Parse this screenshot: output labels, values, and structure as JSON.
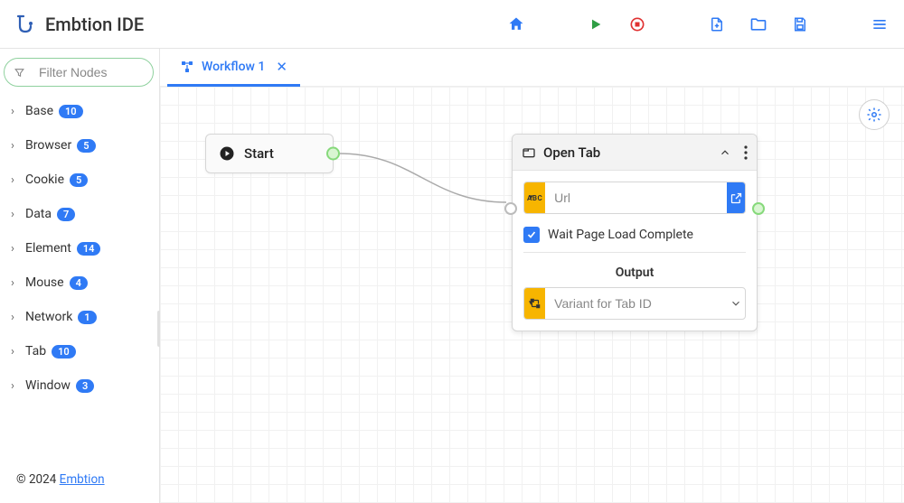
{
  "brand": {
    "title": "Embtion IDE"
  },
  "filter": {
    "placeholder": "Filter Nodes"
  },
  "categories": [
    {
      "name": "Base",
      "count": "10"
    },
    {
      "name": "Browser",
      "count": "5"
    },
    {
      "name": "Cookie",
      "count": "5"
    },
    {
      "name": "Data",
      "count": "7"
    },
    {
      "name": "Element",
      "count": "14"
    },
    {
      "name": "Mouse",
      "count": "4"
    },
    {
      "name": "Network",
      "count": "1"
    },
    {
      "name": "Tab",
      "count": "10"
    },
    {
      "name": "Window",
      "count": "3"
    }
  ],
  "footer": {
    "copyright": "© 2024 ",
    "link": "Embtion"
  },
  "tab": {
    "label": "Workflow 1"
  },
  "start_node": {
    "label": "Start"
  },
  "open_tab_node": {
    "title": "Open Tab",
    "url_placeholder": "Url",
    "wait_label": "Wait Page Load Complete",
    "output_label": "Output",
    "variant_placeholder": "Variant for Tab ID"
  }
}
